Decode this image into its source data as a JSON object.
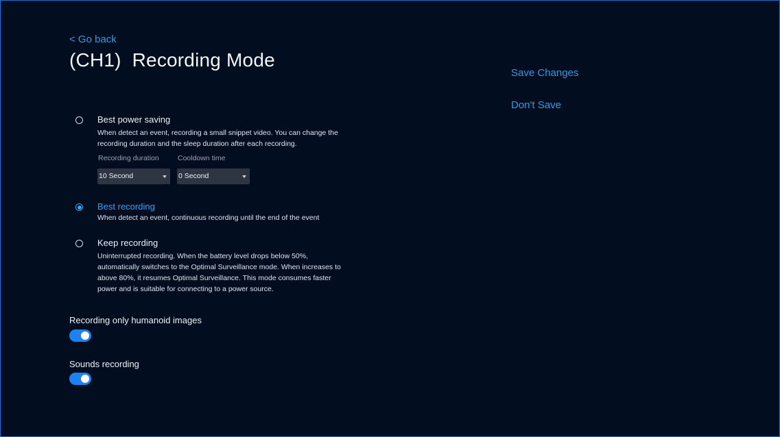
{
  "header": {
    "back_label": "< Go back",
    "title": "(CH1)  Recording Mode"
  },
  "actions": {
    "save_label": "Save Changes",
    "dont_save_label": "Don't Save"
  },
  "options": [
    {
      "label": "Best power saving",
      "description": "When detect an event, recording a small snippet video. You can change the recording duration and the sleep duration after each recording.",
      "selected": false
    },
    {
      "label": "Best recording",
      "description": "When detect an event, continuous recording until the end of the event",
      "selected": true
    },
    {
      "label": "Keep recording",
      "description": "Uninterrupted recording. When the battery level drops below 50%, automatically switches to the Optimal Surveillance mode. When increases to above 80%, it resumes Optimal Surveillance. This mode consumes faster power and is suitable for connecting to a power source.",
      "selected": false
    }
  ],
  "power_saving_settings": {
    "recording_duration_label": "Recording duration",
    "recording_duration_value": "10 Second",
    "cooldown_label": "Cooldown time",
    "cooldown_value": "0 Second"
  },
  "toggles": [
    {
      "label": "Recording only humanoid images",
      "on": true
    },
    {
      "label": "Sounds recording",
      "on": true
    }
  ],
  "colors": {
    "background": "#020d1f",
    "accent": "#2f9be8",
    "toggle_on": "#1c82f0"
  }
}
